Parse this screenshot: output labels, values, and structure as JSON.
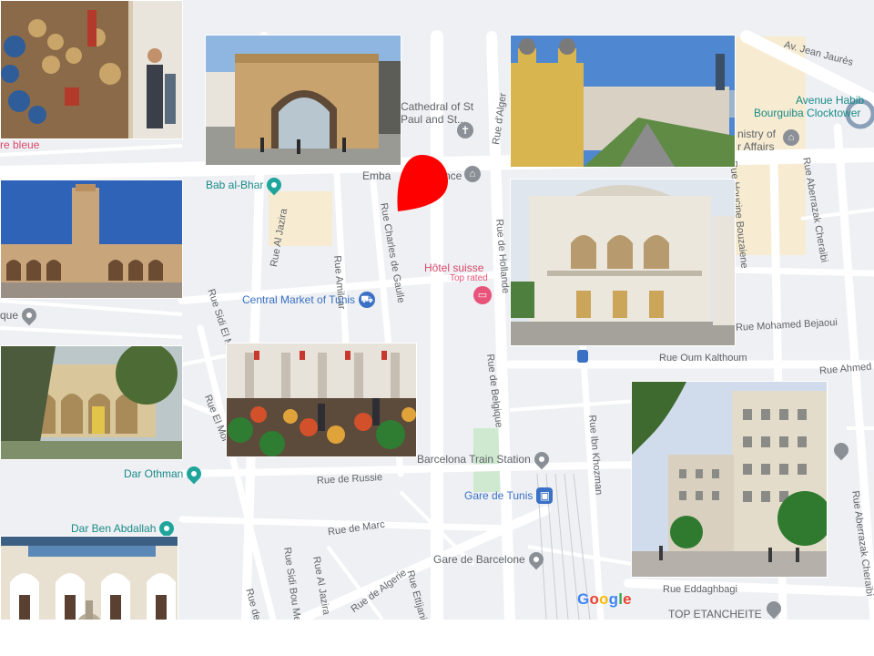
{
  "map": {
    "brand": [
      "G",
      "o",
      "o",
      "g",
      "l",
      "e"
    ],
    "brand_colors": [
      "#4285F4",
      "#EA4335",
      "#FBBC05",
      "#4285F4",
      "#34A853",
      "#EA4335"
    ],
    "marker_color": "#ff0000",
    "streets": {
      "jean_jaures": "Av. Jean Jaurès",
      "al_jazira": "Rue Al Jazira",
      "amilcar": "Rue Amilcar",
      "charles_de_gaulle": "Rue Charles de Gaulle",
      "hollande": "Rue de Hollande",
      "alger": "Rue d'Alger",
      "belgique": "Rue de Belgique",
      "ibn_khozman": "Rue Ibn Khozman",
      "oum_kalthoum": "Rue Oum Kalthoum",
      "ahmed": "Rue Ahmed",
      "mohamed_bejaoui": "Rue Mohamed Bejaoui",
      "houcine_bouzaiene": "Rue Houcine Bouzaiene",
      "aberrazak_cheraibi_1": "Rue Aberrazak Cheraibi",
      "aberrazak_cheraibi_2": "Rue Aberrazak Cheraibi",
      "sidi_el_morjani": "Rue Sidi El Morjani",
      "el_morkad": "Rue El Mor",
      "russie": "Rue de Russie",
      "marc": "Rue de Marc",
      "algerie": "Rue de Algerie",
      "al_jazira_2": "Rue Al Jazira",
      "sidi_boumendil": "Rue Sidi Bou Mendil",
      "ettijani": "Rue Ettijani",
      "de_tr": "Rue de Tr",
      "eddaghbagi": "Rue Eddaghbagi"
    },
    "places": {
      "bab_al_bhar": "Bab al-Bhar",
      "cathedral": "Cathedral of St\nPaul and St...",
      "embassy": "Emba",
      "embassy_tail": "nce",
      "ministry": "nistry of\nr Affairs",
      "avenue_habib": "Avenue Habib",
      "clocktower": "Bourguiba Clocktower",
      "central_market": "Central Market of Tunis",
      "hotel_suisse": "Hôtel suisse",
      "top_rated": "Top rated",
      "barcelona_station": "Barcelona Train Station",
      "gare_tunis": "Gare de Tunis",
      "gare_barcelone": "Gare de Barcelone",
      "dar_othman": "Dar Othman",
      "dar_ben_abdallah": "Dar Ben Abdallah",
      "que": "que",
      "medina_blue": "re bleue",
      "top_etancheite": "TOP ETANCHEITE"
    }
  },
  "photos": [
    {
      "id": "souk-shop"
    },
    {
      "id": "bab-el-bhar-gate"
    },
    {
      "id": "cathedral-avenue"
    },
    {
      "id": "zitouna-mosque"
    },
    {
      "id": "municipal-theatre"
    },
    {
      "id": "dar-courtyard"
    },
    {
      "id": "central-market"
    },
    {
      "id": "avenue-buildings"
    },
    {
      "id": "palace-courtyard"
    }
  ]
}
